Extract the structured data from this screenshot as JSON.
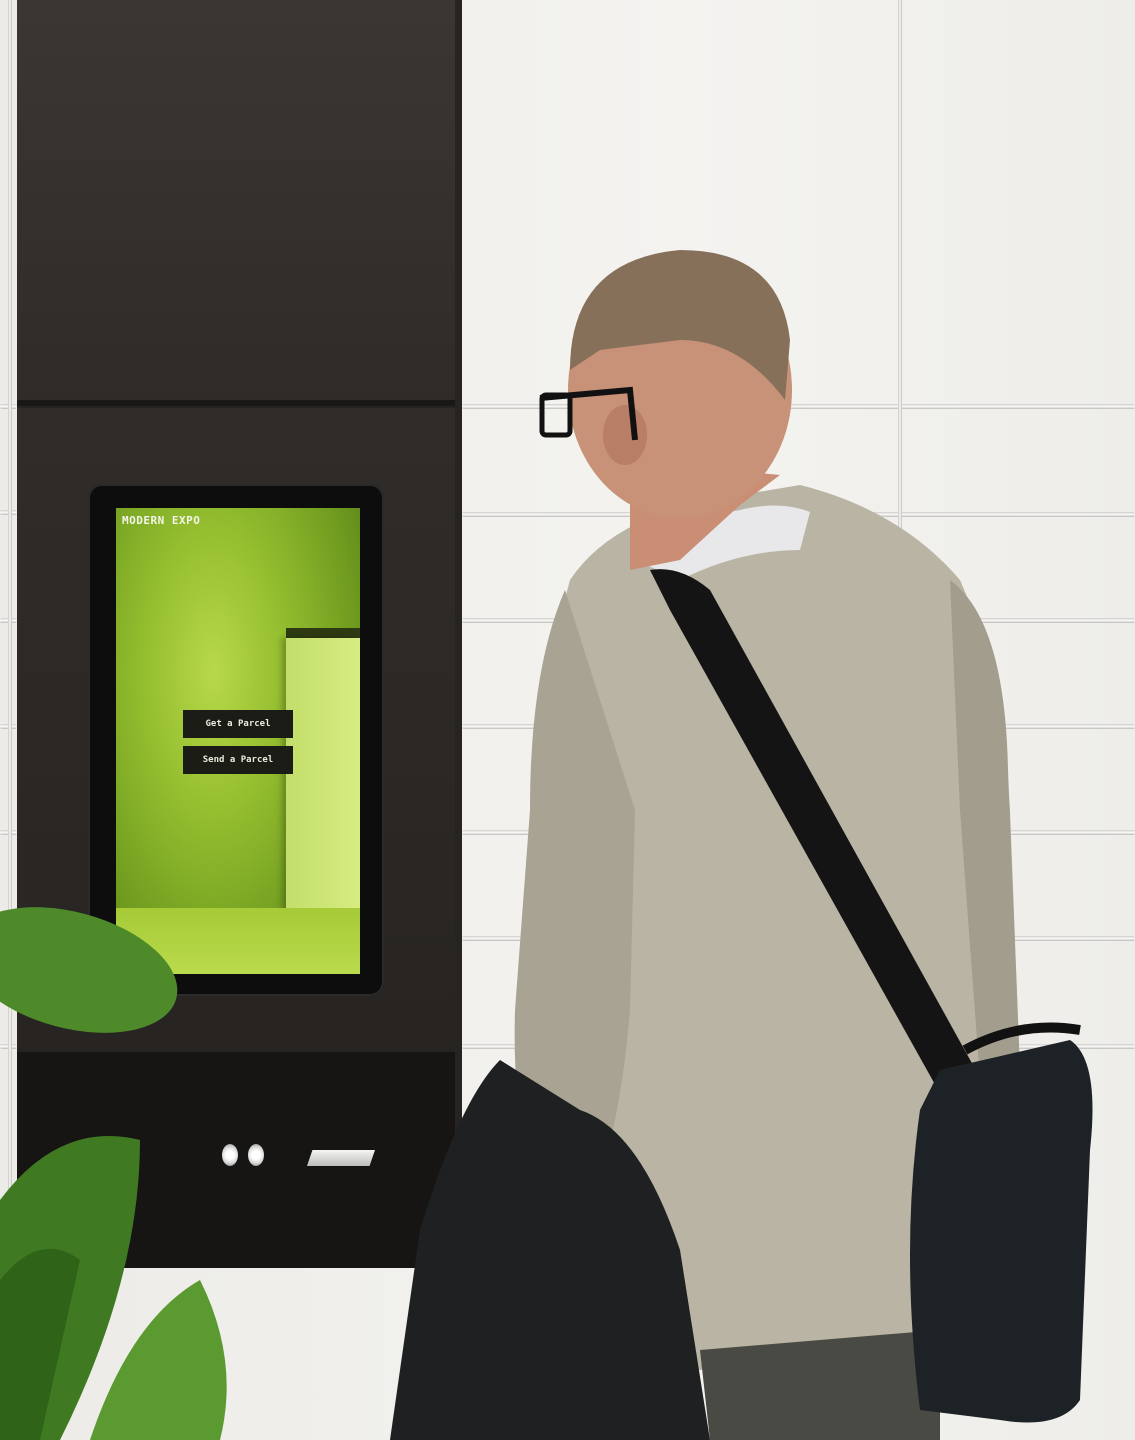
{
  "kiosk": {
    "brand": "MODERN EXPO",
    "buttons": [
      {
        "label": "Get a Parcel"
      },
      {
        "label": "Send a Parcel"
      }
    ],
    "accent_color": "#9cc232",
    "button_color": "#1b1c16"
  }
}
